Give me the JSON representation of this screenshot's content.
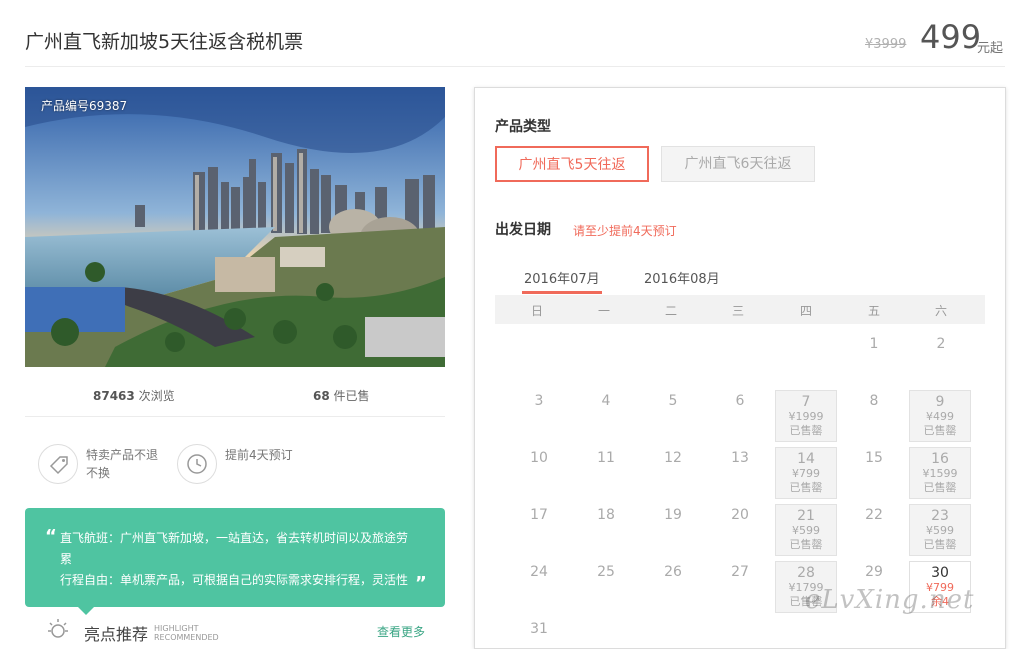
{
  "header": {
    "title": "广州直飞新加坡5天往返含税机票",
    "price_old": "¥3999",
    "price_now": "499",
    "price_unit": "元起"
  },
  "photo": {
    "product_no": "产品编号69387"
  },
  "stats": {
    "views_num": "87463",
    "views_label": "次浏览",
    "sold_num": "68",
    "sold_label": "件已售"
  },
  "policies": [
    {
      "icon": "tag-icon",
      "text": "特卖产品不退不换"
    },
    {
      "icon": "clock-icon",
      "text": "提前4天预订"
    }
  ],
  "highlight_box": {
    "line1": "直飞航班：广州直飞新加坡，一站直达，省去转机时间以及旅途劳累",
    "line2": "行程自由：单机票产品，可根据自己的实际需求安排行程，灵活性",
    "quote_open": "“",
    "quote_close": "”"
  },
  "highlights": {
    "title": "亮点推荐",
    "en_line1": "HIGHLIGHT",
    "en_line2": "RECOMMENDED",
    "more": "查看更多",
    "icon": "bulb-icon"
  },
  "booking": {
    "type_label": "产品类型",
    "types": [
      "广州直飞5天往返",
      "广州直飞6天往返"
    ],
    "date_label": "出发日期",
    "date_hint": "请至少提前4天预订",
    "months": [
      "2016年07月",
      "2016年08月"
    ],
    "weekdays": [
      "日",
      "一",
      "二",
      "三",
      "四",
      "五",
      "六"
    ]
  },
  "calendar": {
    "plain_days": [
      "1",
      "2",
      "3",
      "4",
      "5",
      "6",
      "8",
      "10",
      "11",
      "12",
      "13",
      "15",
      "17",
      "18",
      "19",
      "20",
      "22",
      "24",
      "25",
      "26",
      "27",
      "29",
      "31"
    ],
    "cells": [
      {
        "day": "7",
        "price": "¥1999",
        "status": "已售罄"
      },
      {
        "day": "9",
        "price": "¥499",
        "status": "已售罄"
      },
      {
        "day": "14",
        "price": "¥799",
        "status": "已售罄"
      },
      {
        "day": "16",
        "price": "¥1599",
        "status": "已售罄"
      },
      {
        "day": "21",
        "price": "¥599",
        "status": "已售罄"
      },
      {
        "day": "23",
        "price": "¥599",
        "status": "已售罄"
      },
      {
        "day": "28",
        "price": "¥1799",
        "status": "已售罄"
      },
      {
        "day": "30",
        "price": "¥799",
        "status": "余4"
      }
    ]
  },
  "watermark": "eLvXing.net"
}
